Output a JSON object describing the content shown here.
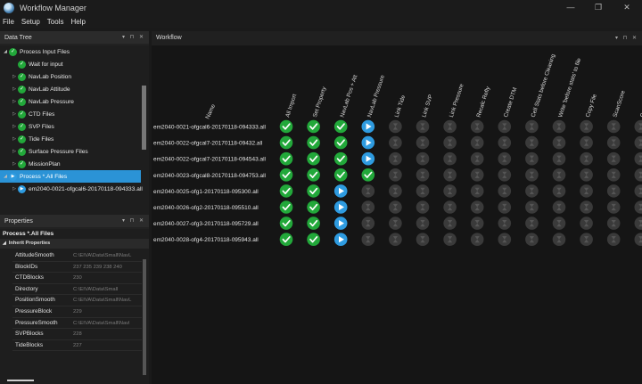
{
  "window": {
    "title": "Workflow Manager",
    "minimize": "—",
    "maximize": "❐",
    "close": "✕"
  },
  "menu": [
    "File",
    "Setup",
    "Tools",
    "Help"
  ],
  "data_tree": {
    "title": "Data Tree",
    "controls": "▾ ⊓ ✕",
    "items": [
      {
        "label": "Process Input Files",
        "indent": 0,
        "twisty": "◢",
        "status": "done"
      },
      {
        "label": "Wait for input",
        "indent": 1,
        "twisty": "",
        "status": "done"
      },
      {
        "label": "NavLab Position",
        "indent": 1,
        "twisty": "▷",
        "status": "done"
      },
      {
        "label": "NavLab Attitude",
        "indent": 1,
        "twisty": "▷",
        "status": "done"
      },
      {
        "label": "NavLab Pressure",
        "indent": 1,
        "twisty": "▷",
        "status": "done"
      },
      {
        "label": "CTD Files",
        "indent": 1,
        "twisty": "▷",
        "status": "done"
      },
      {
        "label": "SVP Files",
        "indent": 1,
        "twisty": "▷",
        "status": "done"
      },
      {
        "label": "Tide Files",
        "indent": 1,
        "twisty": "▷",
        "status": "done"
      },
      {
        "label": "Surface Pressure Files",
        "indent": 1,
        "twisty": "▷",
        "status": "done"
      },
      {
        "label": "MissionPlan",
        "indent": 1,
        "twisty": "▷",
        "status": "done"
      },
      {
        "label": "Process *.All Files",
        "indent": 0,
        "twisty": "◢",
        "status": "running",
        "selected": true
      },
      {
        "label": "em2040-0021-ofgcal6-20170118-094333.all",
        "indent": 1,
        "twisty": "▷",
        "status": "running"
      }
    ]
  },
  "properties": {
    "title": "Properties",
    "controls": "▾ ⊓ ✕",
    "object": "Process *.All Files",
    "section": "Inherit Properties",
    "rows": [
      {
        "key": "AttitudeSmooth",
        "value": "C:\\EIVA\\Data\\Small\\NavL"
      },
      {
        "key": "BlockIDs",
        "value": "237 235 239 238 240"
      },
      {
        "key": "CTDBlocks",
        "value": "230"
      },
      {
        "key": "Directory",
        "value": "C:\\EIVA\\Data\\Small"
      },
      {
        "key": "PositionSmooth",
        "value": "C:\\EIVA\\Data\\Small\\NavL"
      },
      {
        "key": "PressureBlock",
        "value": "229"
      },
      {
        "key": "PressureSmooth",
        "value": "C:\\EIVA\\Data\\Small\\Navl"
      },
      {
        "key": "SVPBlocks",
        "value": "228"
      },
      {
        "key": "TideBlocks",
        "value": "227"
      }
    ]
  },
  "workflow": {
    "title": "Workflow",
    "controls": "▾ ⊓ ✕",
    "name_header": "Name",
    "columns": [
      "All Import",
      "Set Property",
      "NavLab Pos + Att",
      "NavLab Pressure",
      "Link Tide",
      "Link SVP",
      "Link Pressure",
      "Recalc Refly",
      "Create DTM",
      "Cell Stats before Cleaning",
      "Write 'before stats' to file",
      "Copy File",
      "ScanScore",
      "Cell Stats aft"
    ],
    "rows": [
      {
        "name": "em2040-0021-ofgcal6-20170118-094333.all",
        "states": [
          "done",
          "done",
          "done",
          "play",
          "wait",
          "wait",
          "wait",
          "wait",
          "wait",
          "wait",
          "wait",
          "wait",
          "wait",
          "wait"
        ]
      },
      {
        "name": "em2040-0022-ofgcal7-20170118-09432.all",
        "states": [
          "done",
          "done",
          "done",
          "play",
          "wait",
          "wait",
          "wait",
          "wait",
          "wait",
          "wait",
          "wait",
          "wait",
          "wait",
          "wait"
        ]
      },
      {
        "name": "em2040-0022-ofgcal7-20170118-094543.all",
        "states": [
          "done",
          "done",
          "done",
          "play",
          "wait",
          "wait",
          "wait",
          "wait",
          "wait",
          "wait",
          "wait",
          "wait",
          "wait",
          "wait"
        ]
      },
      {
        "name": "em2040-0023-ofgcal8-20170118-094753.all",
        "states": [
          "done",
          "done",
          "done",
          "done",
          "wait",
          "wait",
          "wait",
          "wait",
          "wait",
          "wait",
          "wait",
          "wait",
          "wait",
          "wait"
        ]
      },
      {
        "name": "em2040-0025-ofg1-20170118-095300.all",
        "states": [
          "done",
          "done",
          "play",
          "wait",
          "wait",
          "wait",
          "wait",
          "wait",
          "wait",
          "wait",
          "wait",
          "wait",
          "wait",
          "wait"
        ]
      },
      {
        "name": "em2040-0026-ofg2-20170118-095510.all",
        "states": [
          "done",
          "done",
          "play",
          "wait",
          "wait",
          "wait",
          "wait",
          "wait",
          "wait",
          "wait",
          "wait",
          "wait",
          "wait",
          "wait"
        ]
      },
      {
        "name": "em2040-0027-ofg3-20170118-095729.all",
        "states": [
          "done",
          "done",
          "play",
          "wait",
          "wait",
          "wait",
          "wait",
          "wait",
          "wait",
          "wait",
          "wait",
          "wait",
          "wait",
          "wait"
        ]
      },
      {
        "name": "em2040-0028-ofg4-20170118-095943.all",
        "states": [
          "done",
          "done",
          "play",
          "wait",
          "wait",
          "wait",
          "wait",
          "wait",
          "wait",
          "wait",
          "wait",
          "wait",
          "wait",
          "wait"
        ]
      }
    ]
  },
  "icons": {
    "app": "workflow-app-icon",
    "done": "check-circle-icon",
    "play": "play-circle-icon",
    "wait": "hourglass-icon"
  },
  "colors": {
    "done": "#22a83a",
    "play": "#2e9be0",
    "wait": "#3a3a3a",
    "selection": "#2b93d6"
  }
}
